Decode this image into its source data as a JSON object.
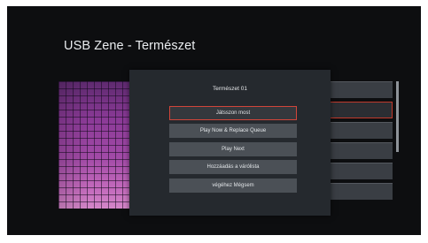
{
  "screen": {
    "title": "USB Zene - Természet"
  },
  "dialog": {
    "title": "Természet 01",
    "options": [
      {
        "label": "Játsszon most",
        "focused": true
      },
      {
        "label": "Play Now & Replace Queue",
        "focused": false
      },
      {
        "label": "Play Next",
        "focused": false
      },
      {
        "label": "Hozzáadás a várólista",
        "focused": false
      },
      {
        "label": "végéhez Mégsem",
        "focused": false
      }
    ]
  },
  "colors": {
    "background": "#0d0e10",
    "dialog": "#25292e",
    "option": "#4b5056",
    "focus_border": "#d0453a",
    "album_art": "#8b3a97"
  }
}
